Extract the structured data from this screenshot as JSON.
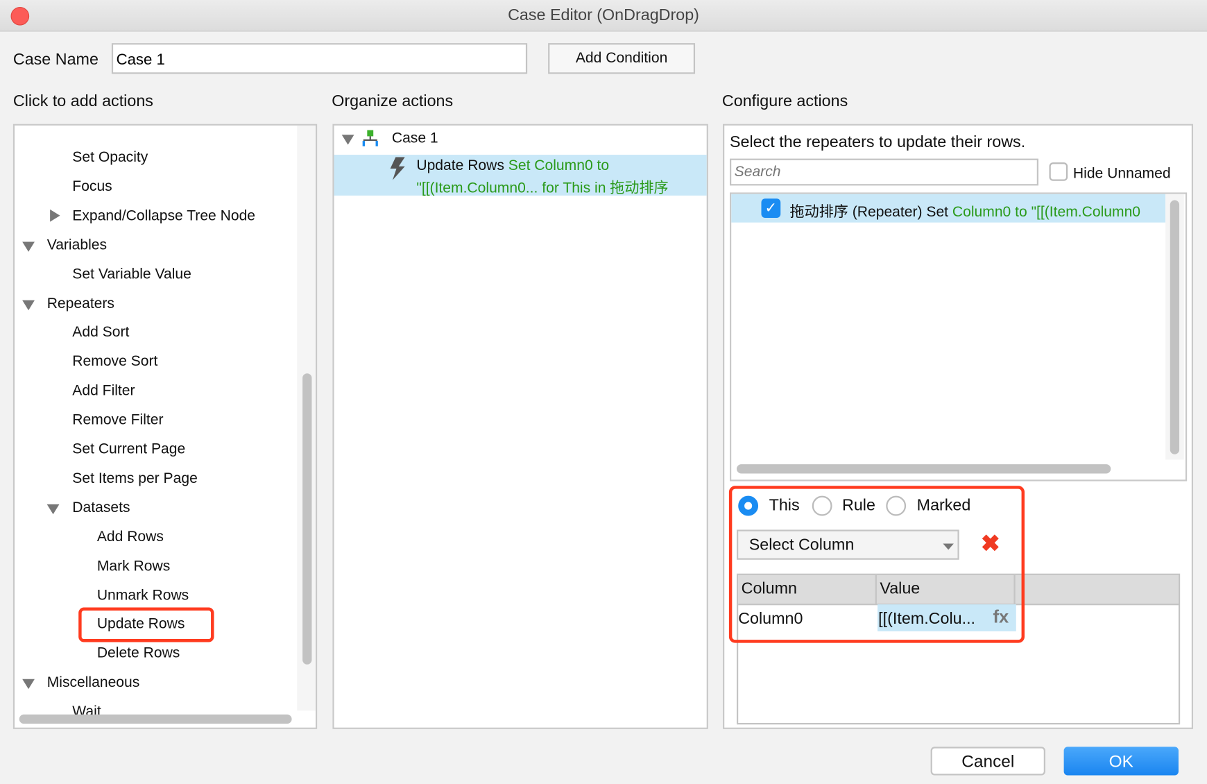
{
  "window": {
    "title": "Case Editor (OnDragDrop)"
  },
  "case_name": {
    "label": "Case Name",
    "value": "Case 1"
  },
  "add_condition": "Add Condition",
  "sections": {
    "add": "Click to add actions",
    "organize": "Organize actions",
    "configure": "Configure actions"
  },
  "actions": [
    {
      "label": "Set Opacity",
      "level": 2,
      "arrow": ""
    },
    {
      "label": "Focus",
      "level": 2,
      "arrow": ""
    },
    {
      "label": "Expand/Collapse Tree Node",
      "level": 2,
      "arrow": "right"
    },
    {
      "label": "Variables",
      "level": 1,
      "arrow": "down"
    },
    {
      "label": "Set Variable Value",
      "level": 2,
      "arrow": ""
    },
    {
      "label": "Repeaters",
      "level": 1,
      "arrow": "down"
    },
    {
      "label": "Add Sort",
      "level": 2,
      "arrow": ""
    },
    {
      "label": "Remove Sort",
      "level": 2,
      "arrow": ""
    },
    {
      "label": "Add Filter",
      "level": 2,
      "arrow": ""
    },
    {
      "label": "Remove Filter",
      "level": 2,
      "arrow": ""
    },
    {
      "label": "Set Current Page",
      "level": 2,
      "arrow": ""
    },
    {
      "label": "Set Items per Page",
      "level": 2,
      "arrow": ""
    },
    {
      "label": "Datasets",
      "level": 2,
      "arrow": "down"
    },
    {
      "label": "Add Rows",
      "level": 3,
      "arrow": ""
    },
    {
      "label": "Mark Rows",
      "level": 3,
      "arrow": ""
    },
    {
      "label": "Unmark Rows",
      "level": 3,
      "arrow": ""
    },
    {
      "label": "Update Rows",
      "level": 3,
      "arrow": "",
      "highlighted": true
    },
    {
      "label": "Delete Rows",
      "level": 3,
      "arrow": ""
    },
    {
      "label": "Miscellaneous",
      "level": 1,
      "arrow": "down"
    },
    {
      "label": "Wait",
      "level": 2,
      "arrow": ""
    }
  ],
  "organize": {
    "case": "Case 1",
    "action_name": "Update Rows",
    "action_detail_1": "Set Column0 to",
    "action_detail_2": "\"[[(Item.Column0... for This in 拖动排序"
  },
  "configure": {
    "instruction": "Select the repeaters to update their rows.",
    "search_placeholder": "Search",
    "hide_unnamed": "Hide Unnamed",
    "hide_unnamed_checked": false,
    "repeater": {
      "name": "拖动排序 (Repeater) Set ",
      "detail": "Column0 to \"[[(Item.Column0",
      "checked": true
    },
    "radios": [
      {
        "label": "This",
        "selected": true
      },
      {
        "label": "Rule",
        "selected": false
      },
      {
        "label": "Marked",
        "selected": false
      }
    ],
    "select_column": "Select Column",
    "table": {
      "headers": [
        "Column",
        "Value"
      ],
      "rows": [
        {
          "column": "Column0",
          "value": "[[(Item.Colu...",
          "fx": "fx"
        }
      ]
    }
  },
  "buttons": {
    "cancel": "Cancel",
    "ok": "OK"
  },
  "colors": {
    "accent": "#1a8cf2",
    "highlight_box": "#ff3b1f",
    "green_text": "#2a9a1a",
    "selection": "#c9e8f8"
  }
}
